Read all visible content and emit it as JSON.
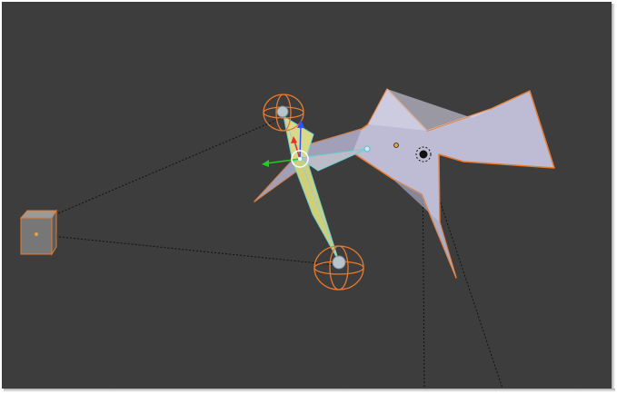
{
  "viewport": {
    "background_color": "#3d3d3d",
    "selection_color": "#e67a2e",
    "bone_fill_color": "#d9d98a",
    "mesh_color": "#b9b8cf",
    "axis_colors": {
      "x": "#e03030",
      "y": "#22cc22",
      "z": "#3355ee"
    }
  },
  "scene_objects": [
    {
      "name": "cube-object",
      "icon": "cube-icon"
    },
    {
      "name": "bird-mesh",
      "icon": "mesh-icon"
    },
    {
      "name": "armature",
      "icon": "bone-icon"
    },
    {
      "name": "empty-upper",
      "icon": "sphere-icon"
    },
    {
      "name": "empty-lower",
      "icon": "sphere-icon"
    },
    {
      "name": "lamp",
      "icon": "lamp-icon"
    }
  ]
}
